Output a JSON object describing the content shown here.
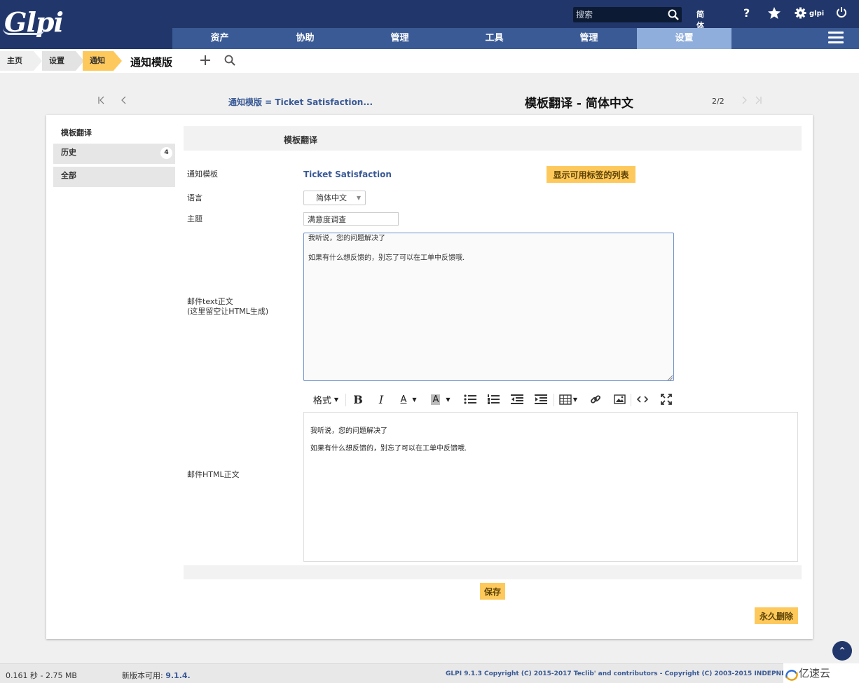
{
  "header": {
    "logo": "Glpi",
    "search_placeholder": "搜索",
    "language": "简体中文",
    "help": "?",
    "user": "glpi"
  },
  "nav": {
    "items": [
      "资产",
      "协助",
      "管理",
      "工具",
      "管理",
      "设置"
    ],
    "active_index": 5
  },
  "breadcrumb": {
    "items": [
      "主页",
      "设置",
      "通知"
    ],
    "title": "通知模版"
  },
  "pager": {
    "link": "通知模版 = Ticket Satisfaction...",
    "title": "模板翻译 - 简体中文",
    "position": "2/2"
  },
  "tabs": {
    "title": "模板翻译",
    "items": [
      {
        "label": "历史",
        "count": "4"
      },
      {
        "label": "全部",
        "count": ""
      }
    ]
  },
  "form": {
    "header": "模板翻译",
    "template_label": "通知模板",
    "template_value": "Ticket Satisfaction",
    "show_tags_button": "显示可用标签的列表",
    "language_label": "语言",
    "language_value": "简体中文",
    "subject_label": "主题",
    "subject_value": "满意度调查",
    "text_label_line1": "邮件text正文",
    "text_label_line2": "(这里留空让HTML生成)",
    "text_line1": "我听说，您的问题解决了",
    "text_line2": "如果有什么想反馈的，别忘了可以在工单中反馈哦.",
    "html_label": "邮件HTML正文",
    "toolbar_format": "格式",
    "html_line1": "我听说，您的问题解决了",
    "html_line2": "如果有什么想反馈的，别忘了可以在工单中反馈哦.",
    "save_button": "保存",
    "delete_button": "永久删除"
  },
  "footer": {
    "timing": "0.161 秒 - 2.75 MB",
    "new_version_label": "新版本可用:",
    "new_version": "9.1.4.",
    "copyright": "GLPI 9.1.3 Copyright (C) 2015-2017 Teclib' and contributors - Copyright (C) 2003-2015 INDEPNET Development Team",
    "watermark": "亿速云"
  },
  "colors": {
    "header_bg": "#21376b",
    "nav_bg": "#3a5a96",
    "nav_active": "#8faedb",
    "button_yellow": "#fec95c",
    "link": "#3a5a96"
  }
}
